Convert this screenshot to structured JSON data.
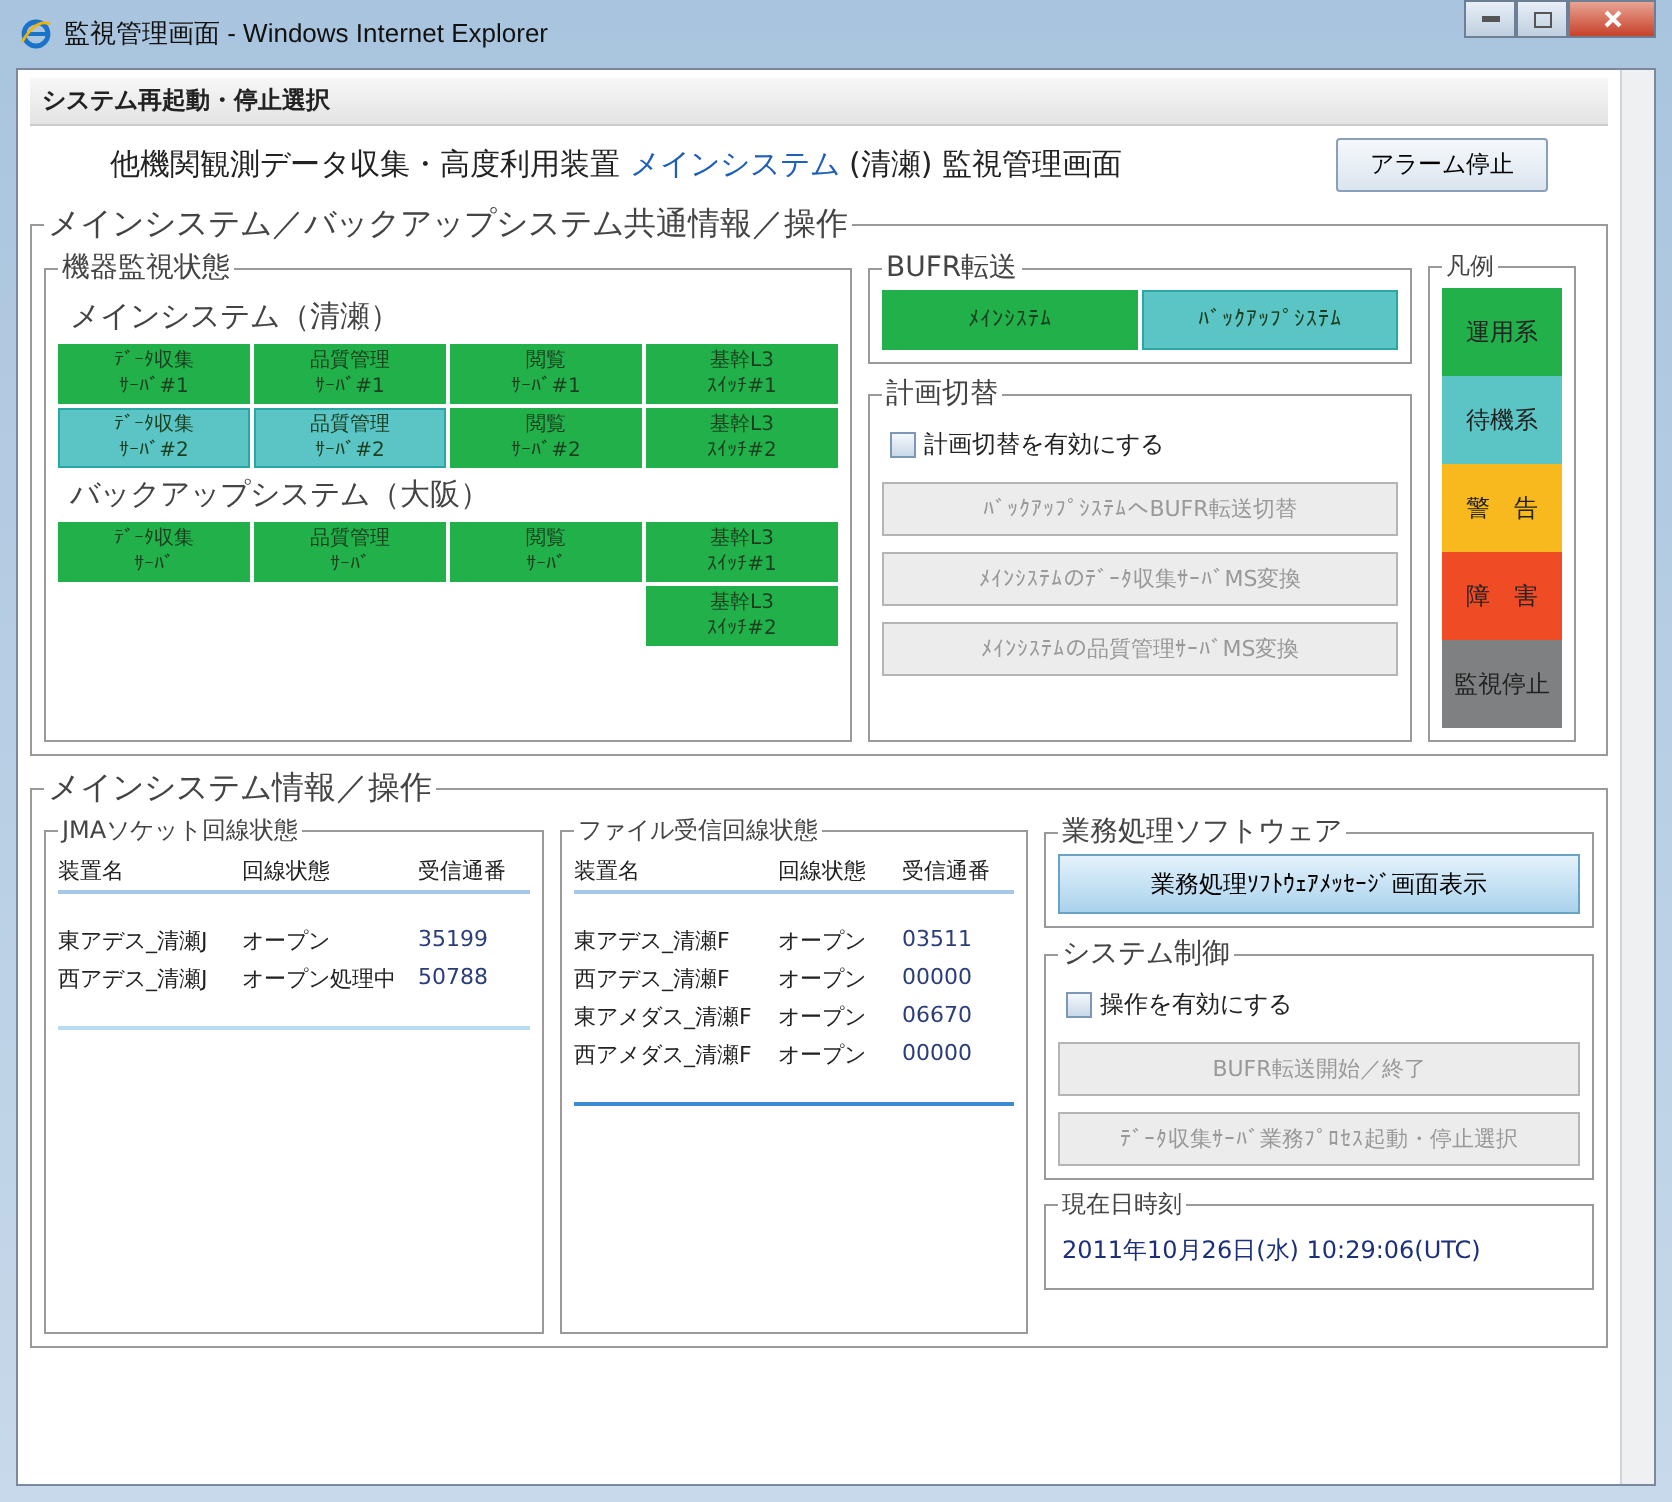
{
  "window": {
    "title": "監視管理画面 - Windows Internet Explorer"
  },
  "header_bar": {
    "label": "システム再起動・停止選択"
  },
  "page_title": {
    "segments": [
      {
        "text": "他機関観測データ収集・高度利用装置 ",
        "highlight": false
      },
      {
        "text": "メインシステム",
        "highlight": true
      },
      {
        "text": " (清瀬) 監視管理画面",
        "highlight": false
      }
    ]
  },
  "alarm_stop_button": "アラーム停止",
  "shared_group": {
    "title": "メインシステム／バックアップシステム共通情報／操作",
    "device_monitor": {
      "title": "機器監視状態",
      "sections": [
        {
          "title": "メインシステム（清瀬）",
          "rows": [
            [
              {
                "line1": "ﾃﾞｰﾀ収集",
                "line2": "ｻｰﾊﾞ#1",
                "standby": false
              },
              {
                "line1": "品質管理",
                "line2": "ｻｰﾊﾞ#1",
                "standby": false
              },
              {
                "line1": "閲覧",
                "line2": "ｻｰﾊﾞ#1",
                "standby": false
              },
              {
                "line1": "基幹L3",
                "line2": "ｽｲｯﾁ#1",
                "standby": false
              }
            ],
            [
              {
                "line1": "ﾃﾞｰﾀ収集",
                "line2": "ｻｰﾊﾞ#2",
                "standby": true
              },
              {
                "line1": "品質管理",
                "line2": "ｻｰﾊﾞ#2",
                "standby": true
              },
              {
                "line1": "閲覧",
                "line2": "ｻｰﾊﾞ#2",
                "standby": false
              },
              {
                "line1": "基幹L3",
                "line2": "ｽｲｯﾁ#2",
                "standby": false
              }
            ]
          ]
        },
        {
          "title": "バックアップシステム（大阪）",
          "rows": [
            [
              {
                "line1": "ﾃﾞｰﾀ収集",
                "line2": "ｻｰﾊﾞ",
                "standby": false
              },
              {
                "line1": "品質管理",
                "line2": "ｻｰﾊﾞ",
                "standby": false
              },
              {
                "line1": "閲覧",
                "line2": "ｻｰﾊﾞ",
                "standby": false
              },
              {
                "line1": "基幹L3",
                "line2": "ｽｲｯﾁ#1",
                "standby": false
              }
            ],
            [
              null,
              null,
              null,
              {
                "line1": "基幹L3",
                "line2": "ｽｲｯﾁ#2",
                "standby": false
              }
            ]
          ]
        }
      ]
    },
    "bufr_transfer": {
      "title": "BUFR転送",
      "items": [
        {
          "label": "ﾒｲﾝｼｽﾃﾑ",
          "standby": false
        },
        {
          "label": "ﾊﾞｯｸｱｯﾌﾟｼｽﾃﾑ",
          "standby": true
        }
      ]
    },
    "planned_switch": {
      "title": "計画切替",
      "checkbox": {
        "label": "計画切替を有効にする",
        "checked": false
      },
      "buttons": [
        {
          "label": "ﾊﾞｯｸｱｯﾌﾟｼｽﾃﾑへBUFR転送切替",
          "disabled": true
        },
        {
          "label": "ﾒｲﾝｼｽﾃﾑのﾃﾞｰﾀ収集ｻｰﾊﾞMS変換",
          "disabled": true
        },
        {
          "label": "ﾒｲﾝｼｽﾃﾑの品質管理ｻｰﾊﾞMS変換",
          "disabled": true
        }
      ]
    },
    "legend": {
      "title": "凡例",
      "items": [
        {
          "label": "運用系",
          "color": "#22b04a"
        },
        {
          "label": "待機系",
          "color": "#5bc4c4"
        },
        {
          "label": "警　告",
          "color": "#f8b91e"
        },
        {
          "label": "障　害",
          "color": "#ef4b24"
        },
        {
          "label": "監視停止",
          "color": "#7e8081"
        }
      ]
    }
  },
  "main_group": {
    "title": "メインシステム情報／操作",
    "jma_socket": {
      "title": "JMAソケット回線状態",
      "columns": [
        "装置名",
        "回線状態",
        "受信通番"
      ],
      "rows": [
        [
          "東アデス_清瀬J",
          "オープン",
          "35199"
        ],
        [
          "西アデス_清瀬J",
          "オープン処理中",
          "50788"
        ]
      ]
    },
    "file_receive": {
      "title": "ファイル受信回線状態",
      "columns": [
        "装置名",
        "回線状態",
        "受信通番"
      ],
      "rows": [
        [
          "東アデス_清瀬F",
          "オープン",
          "03511"
        ],
        [
          "西アデス_清瀬F",
          "オープン",
          "00000"
        ],
        [
          "東アメダス_清瀬F",
          "オープン",
          "06670"
        ],
        [
          "西アメダス_清瀬F",
          "オープン",
          "00000"
        ]
      ]
    },
    "business_software": {
      "title": "業務処理ソフトウェア",
      "button": "業務処理ｿﾌﾄｳｪｱﾒｯｾｰｼﾞ画面表示"
    },
    "system_control": {
      "title": "システム制御",
      "checkbox": {
        "label": "操作を有効にする",
        "checked": false
      },
      "buttons": [
        {
          "label": "BUFR転送開始／終了",
          "disabled": true
        },
        {
          "label": "ﾃﾞｰﾀ収集ｻｰﾊﾞ業務ﾌﾟﾛｾｽ起動・停止選択",
          "disabled": true
        }
      ]
    },
    "current_time": {
      "title": "現在日時刻",
      "value": "2011年10月26日(水) 10:29:06(UTC)"
    }
  }
}
